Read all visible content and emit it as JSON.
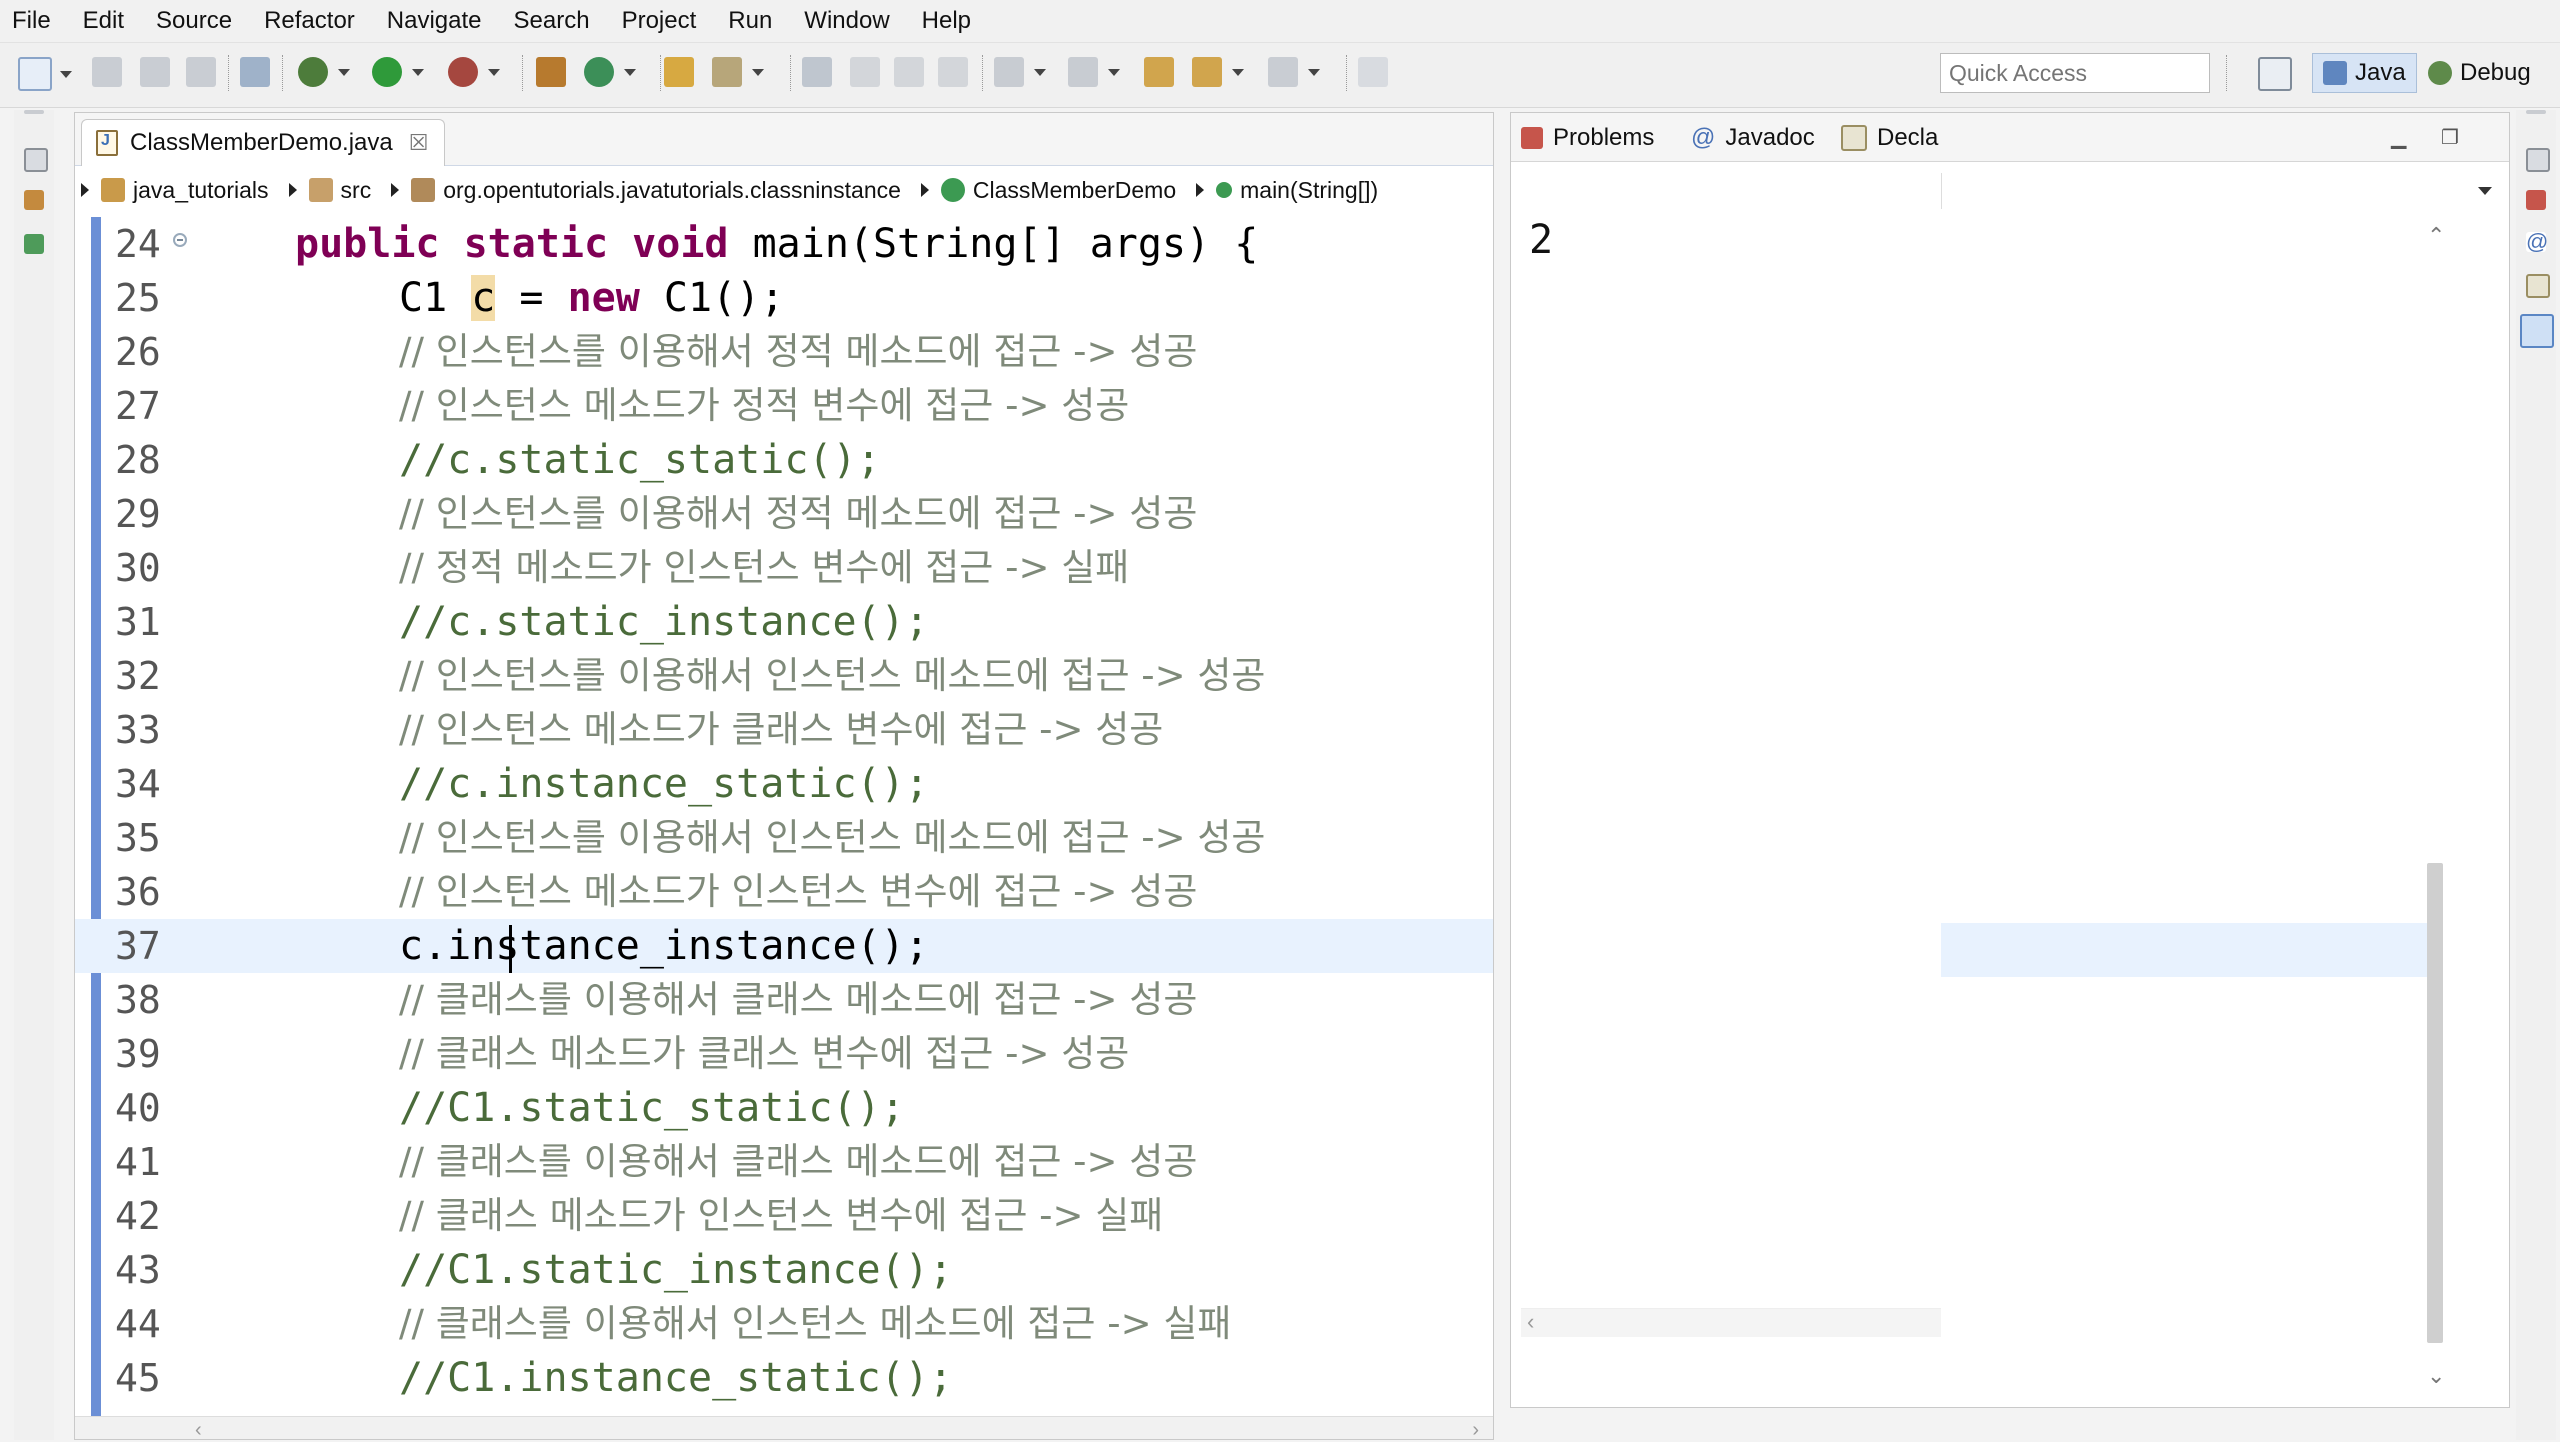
{
  "menu": [
    "File",
    "Edit",
    "Source",
    "Refactor",
    "Navigate",
    "Search",
    "Project",
    "Run",
    "Window",
    "Help"
  ],
  "toolbar": {
    "quick_access_placeholder": "Quick Access",
    "perspectives": [
      {
        "label": "Java",
        "active": true
      },
      {
        "label": "Debug",
        "active": false
      }
    ]
  },
  "editor": {
    "tab_title": "ClassMemberDemo.java",
    "breadcrumb": [
      "java_tutorials",
      "src",
      "org.opentutorials.javatutorials.classninstance",
      "ClassMemberDemo",
      "main(String[])"
    ],
    "lines": [
      {
        "n": "24",
        "text": "public static void main(String[] args) {"
      },
      {
        "n": "25",
        "text": "C1 c = new C1();"
      },
      {
        "n": "26",
        "text": "// 인스턴스를 이용해서 정적 메소드에 접근 -> 성공"
      },
      {
        "n": "27",
        "text": "// 인스턴스 메소드가 정적 변수에 접근 -> 성공"
      },
      {
        "n": "28",
        "text": "//c.static_static();"
      },
      {
        "n": "29",
        "text": "// 인스턴스를 이용해서 정적 메소드에 접근 -> 성공"
      },
      {
        "n": "30",
        "text": "// 정적 메소드가 인스턴스 변수에 접근 -> 실패"
      },
      {
        "n": "31",
        "text": "//c.static_instance();"
      },
      {
        "n": "32",
        "text": "// 인스턴스를 이용해서 인스턴스 메소드에 접근 -> 성공"
      },
      {
        "n": "33",
        "text": "// 인스턴스 메소드가 클래스 변수에 접근 -> 성공"
      },
      {
        "n": "34",
        "text": "//c.instance_static();"
      },
      {
        "n": "35",
        "text": "// 인스턴스를 이용해서 인스턴스 메소드에 접근 -> 성공"
      },
      {
        "n": "36",
        "text": "// 인스턴스 메소드가 인스턴스 변수에 접근 -> 성공"
      },
      {
        "n": "37",
        "text": "c.instance_instance();"
      },
      {
        "n": "38",
        "text": "// 클래스를 이용해서 클래스 메소드에 접근 -> 성공"
      },
      {
        "n": "39",
        "text": "// 클래스 메소드가 클래스 변수에 접근 -> 성공"
      },
      {
        "n": "40",
        "text": "//C1.static_static();"
      },
      {
        "n": "41",
        "text": "// 클래스를 이용해서 클래스 메소드에 접근 -> 성공"
      },
      {
        "n": "42",
        "text": "// 클래스 메소드가 인스턴스 변수에 접근 -> 실패"
      },
      {
        "n": "43",
        "text": "//C1.static_instance();"
      },
      {
        "n": "44",
        "text": "// 클래스를 이용해서 인스턴스 메소드에 접근 -> 실패"
      },
      {
        "n": "45",
        "text": "//C1.instance_static();"
      }
    ]
  },
  "views": {
    "tabs": [
      "Problems",
      "Javadoc",
      "Decla"
    ],
    "output": "2"
  },
  "colors": {
    "keyword": "#7f0055",
    "comment": "#7f8a7a",
    "current_line": "#e8f2fe",
    "ruler": "#6b8fd6"
  }
}
